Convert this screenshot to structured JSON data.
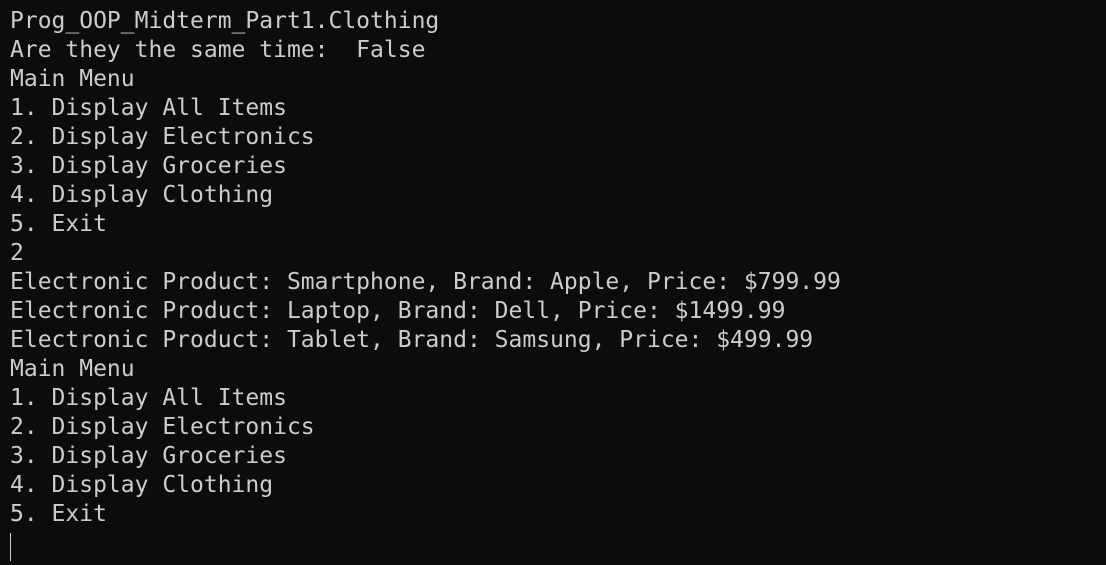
{
  "terminal": {
    "lines": [
      "Prog_OOP_Midterm_Part1.Clothing",
      "Are they the same time:  False",
      "Main Menu",
      "1. Display All Items",
      "2. Display Electronics",
      "3. Display Groceries",
      "4. Display Clothing",
      "5. Exit",
      "2",
      "Electronic Product: Smartphone, Brand: Apple, Price: $799.99",
      "Electronic Product: Laptop, Brand: Dell, Price: $1499.99",
      "Electronic Product: Tablet, Brand: Samsung, Price: $499.99",
      "Main Menu",
      "1. Display All Items",
      "2. Display Electronics",
      "3. Display Groceries",
      "4. Display Clothing",
      "5. Exit"
    ],
    "background_color": "#0c0c0c",
    "text_color": "#cccccc"
  }
}
